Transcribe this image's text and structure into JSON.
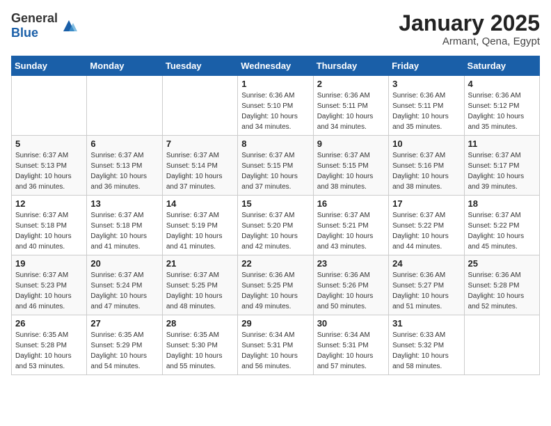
{
  "header": {
    "logo_general": "General",
    "logo_blue": "Blue",
    "month_title": "January 2025",
    "subtitle": "Armant, Qena, Egypt"
  },
  "weekdays": [
    "Sunday",
    "Monday",
    "Tuesday",
    "Wednesday",
    "Thursday",
    "Friday",
    "Saturday"
  ],
  "weeks": [
    [
      {
        "day": "",
        "info": ""
      },
      {
        "day": "",
        "info": ""
      },
      {
        "day": "",
        "info": ""
      },
      {
        "day": "1",
        "info": "Sunrise: 6:36 AM\nSunset: 5:10 PM\nDaylight: 10 hours\nand 34 minutes."
      },
      {
        "day": "2",
        "info": "Sunrise: 6:36 AM\nSunset: 5:11 PM\nDaylight: 10 hours\nand 34 minutes."
      },
      {
        "day": "3",
        "info": "Sunrise: 6:36 AM\nSunset: 5:11 PM\nDaylight: 10 hours\nand 35 minutes."
      },
      {
        "day": "4",
        "info": "Sunrise: 6:36 AM\nSunset: 5:12 PM\nDaylight: 10 hours\nand 35 minutes."
      }
    ],
    [
      {
        "day": "5",
        "info": "Sunrise: 6:37 AM\nSunset: 5:13 PM\nDaylight: 10 hours\nand 36 minutes."
      },
      {
        "day": "6",
        "info": "Sunrise: 6:37 AM\nSunset: 5:13 PM\nDaylight: 10 hours\nand 36 minutes."
      },
      {
        "day": "7",
        "info": "Sunrise: 6:37 AM\nSunset: 5:14 PM\nDaylight: 10 hours\nand 37 minutes."
      },
      {
        "day": "8",
        "info": "Sunrise: 6:37 AM\nSunset: 5:15 PM\nDaylight: 10 hours\nand 37 minutes."
      },
      {
        "day": "9",
        "info": "Sunrise: 6:37 AM\nSunset: 5:15 PM\nDaylight: 10 hours\nand 38 minutes."
      },
      {
        "day": "10",
        "info": "Sunrise: 6:37 AM\nSunset: 5:16 PM\nDaylight: 10 hours\nand 38 minutes."
      },
      {
        "day": "11",
        "info": "Sunrise: 6:37 AM\nSunset: 5:17 PM\nDaylight: 10 hours\nand 39 minutes."
      }
    ],
    [
      {
        "day": "12",
        "info": "Sunrise: 6:37 AM\nSunset: 5:18 PM\nDaylight: 10 hours\nand 40 minutes."
      },
      {
        "day": "13",
        "info": "Sunrise: 6:37 AM\nSunset: 5:18 PM\nDaylight: 10 hours\nand 41 minutes."
      },
      {
        "day": "14",
        "info": "Sunrise: 6:37 AM\nSunset: 5:19 PM\nDaylight: 10 hours\nand 41 minutes."
      },
      {
        "day": "15",
        "info": "Sunrise: 6:37 AM\nSunset: 5:20 PM\nDaylight: 10 hours\nand 42 minutes."
      },
      {
        "day": "16",
        "info": "Sunrise: 6:37 AM\nSunset: 5:21 PM\nDaylight: 10 hours\nand 43 minutes."
      },
      {
        "day": "17",
        "info": "Sunrise: 6:37 AM\nSunset: 5:22 PM\nDaylight: 10 hours\nand 44 minutes."
      },
      {
        "day": "18",
        "info": "Sunrise: 6:37 AM\nSunset: 5:22 PM\nDaylight: 10 hours\nand 45 minutes."
      }
    ],
    [
      {
        "day": "19",
        "info": "Sunrise: 6:37 AM\nSunset: 5:23 PM\nDaylight: 10 hours\nand 46 minutes."
      },
      {
        "day": "20",
        "info": "Sunrise: 6:37 AM\nSunset: 5:24 PM\nDaylight: 10 hours\nand 47 minutes."
      },
      {
        "day": "21",
        "info": "Sunrise: 6:37 AM\nSunset: 5:25 PM\nDaylight: 10 hours\nand 48 minutes."
      },
      {
        "day": "22",
        "info": "Sunrise: 6:36 AM\nSunset: 5:25 PM\nDaylight: 10 hours\nand 49 minutes."
      },
      {
        "day": "23",
        "info": "Sunrise: 6:36 AM\nSunset: 5:26 PM\nDaylight: 10 hours\nand 50 minutes."
      },
      {
        "day": "24",
        "info": "Sunrise: 6:36 AM\nSunset: 5:27 PM\nDaylight: 10 hours\nand 51 minutes."
      },
      {
        "day": "25",
        "info": "Sunrise: 6:36 AM\nSunset: 5:28 PM\nDaylight: 10 hours\nand 52 minutes."
      }
    ],
    [
      {
        "day": "26",
        "info": "Sunrise: 6:35 AM\nSunset: 5:28 PM\nDaylight: 10 hours\nand 53 minutes."
      },
      {
        "day": "27",
        "info": "Sunrise: 6:35 AM\nSunset: 5:29 PM\nDaylight: 10 hours\nand 54 minutes."
      },
      {
        "day": "28",
        "info": "Sunrise: 6:35 AM\nSunset: 5:30 PM\nDaylight: 10 hours\nand 55 minutes."
      },
      {
        "day": "29",
        "info": "Sunrise: 6:34 AM\nSunset: 5:31 PM\nDaylight: 10 hours\nand 56 minutes."
      },
      {
        "day": "30",
        "info": "Sunrise: 6:34 AM\nSunset: 5:31 PM\nDaylight: 10 hours\nand 57 minutes."
      },
      {
        "day": "31",
        "info": "Sunrise: 6:33 AM\nSunset: 5:32 PM\nDaylight: 10 hours\nand 58 minutes."
      },
      {
        "day": "",
        "info": ""
      }
    ]
  ]
}
